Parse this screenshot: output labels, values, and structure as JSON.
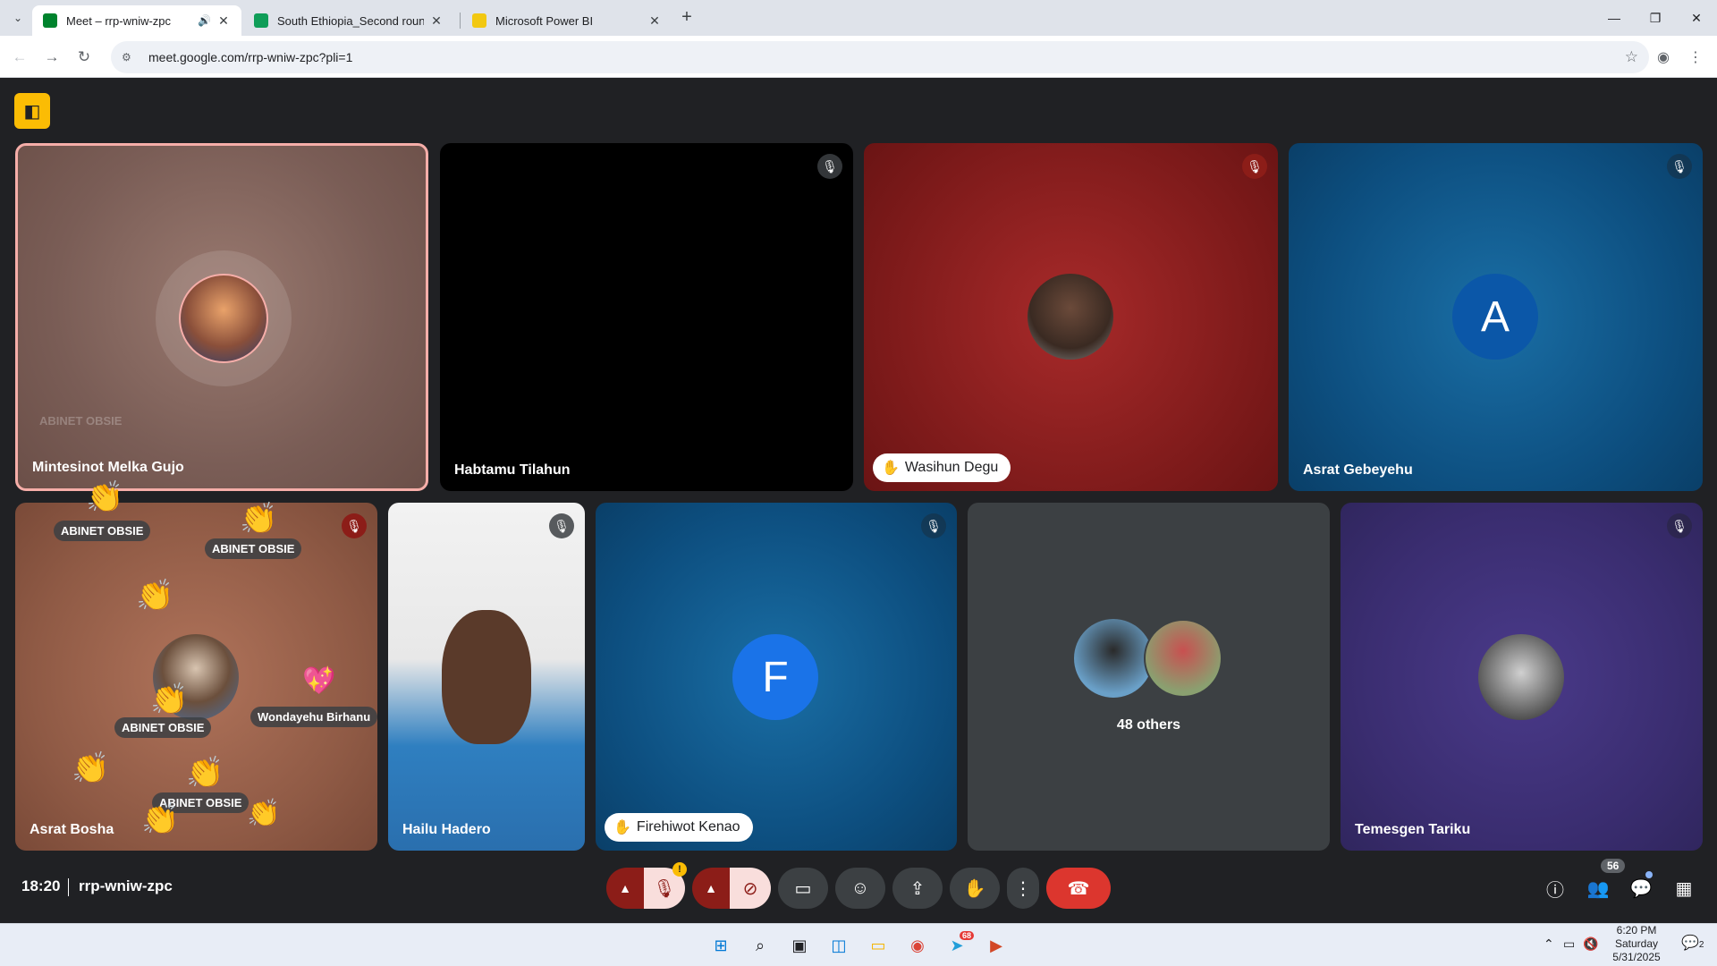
{
  "browser": {
    "tabs": [
      {
        "title": "Meet – rrp-wniw-zpc",
        "active": true
      },
      {
        "title": "South Ethiopia_Second round m",
        "active": false
      },
      {
        "title": "Microsoft Power BI",
        "active": false
      }
    ],
    "url": "meet.google.com/rrp-wniw-zpc?pli=1"
  },
  "meeting": {
    "time": "18:20",
    "code": "rrp-wniw-zpc",
    "participant_count": "56",
    "logo_glyph": "◧"
  },
  "tiles": [
    {
      "name": "Mintesinot Melka Gujo",
      "muted": false,
      "speaking": true
    },
    {
      "name": "Habtamu Tilahun",
      "muted": true
    },
    {
      "name": "Wasihun Degu",
      "muted": true,
      "hand_raised": true
    },
    {
      "name": "Asrat Gebeyehu",
      "muted": true,
      "initial": "A"
    },
    {
      "name": "Asrat Bosha",
      "muted": true
    },
    {
      "name": "Hailu Hadero",
      "muted": true
    },
    {
      "name": "Firehiwot Kenao",
      "muted": true,
      "initial": "F",
      "hand_raised": true
    },
    {
      "name": "48 others"
    },
    {
      "name": "Temesgen Tariku",
      "muted": true
    }
  ],
  "reactions": {
    "names": [
      "ABINET OBSIE",
      "ABINET OBSIE",
      "ABINET OBSIE",
      "ABINET OBSIE",
      "Wondayehu Birhanu",
      "ABINET OBSIE"
    ],
    "emoji_clap": "👏",
    "emoji_heart": "💖"
  },
  "taskbar": {
    "time": "6:20 PM",
    "day": "Saturday",
    "date": "5/31/2025",
    "telegram_badge": "68",
    "notif_count": "2"
  },
  "colors": {
    "end_call": "#dc362e",
    "speaking_border": "#f6aea9",
    "muted_red": "#8c1d18",
    "avatar_blue": "#1a73e8"
  }
}
